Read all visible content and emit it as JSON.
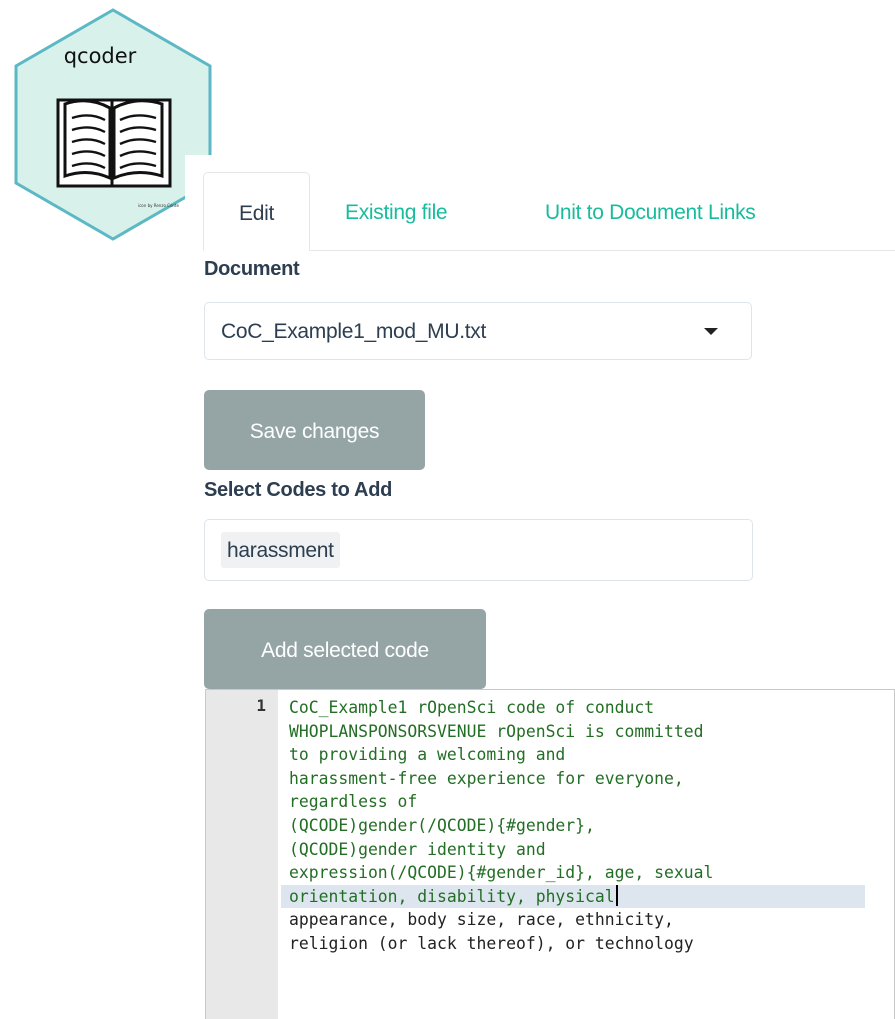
{
  "logo": {
    "title": "qcoder",
    "credit": "icon by Renzo Conte",
    "fill": "#d8f1ea",
    "stroke": "#5db8c5",
    "icon": "open-book-icon"
  },
  "tabs": [
    {
      "label": "Edit",
      "active": true
    },
    {
      "label": "Existing file",
      "active": false
    },
    {
      "label": "Unit to Document Links",
      "active": false
    }
  ],
  "document": {
    "label": "Document",
    "selected": "CoC_Example1_mod_MU.txt"
  },
  "save_button": "Save changes",
  "codes": {
    "label": "Select Codes to Add",
    "selected": [
      "harassment"
    ]
  },
  "add_button": "Add selected code",
  "editor": {
    "line_number": "1",
    "lines": [
      "CoC_Example1 rOpenSci code of conduct",
      "WHOPLANSPONSORSVENUE rOpenSci is committed",
      "to providing a welcoming and",
      "harassment-free experience for everyone,",
      "regardless of",
      "(QCODE)gender(/QCODE){#gender},",
      "(QCODE)gender identity and",
      "expression(/QCODE){#gender_id}, age, sexual",
      "orientation, disability, physical",
      "appearance, body size, race, ethnicity,",
      "religion (or lack thereof), or technology"
    ]
  },
  "colors": {
    "link": "#18bc9c",
    "button": "#95a5a6",
    "text": "#2c3e50",
    "code_green": "#236e25"
  }
}
